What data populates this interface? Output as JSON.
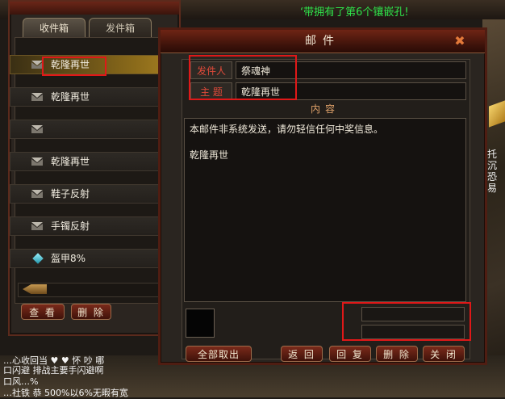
{
  "game": {
    "top_message": "‘带拥有了第6个镶嵌孔!",
    "right_message": "托沉 恐易",
    "bottom_line1": "…心收回当  ♥  ♥  怀 吵 哪",
    "bottom_line2": "口闪避 排战主要手闪避啊",
    "bottom_line3": "口风…%",
    "bottom_line4": "…社铁 恭 500%以6%无暇有宽"
  },
  "inbox": {
    "tabs": [
      {
        "label": "收件箱",
        "active": true
      },
      {
        "label": "发件箱",
        "active": false
      }
    ],
    "mails": [
      {
        "label": "乾隆再世",
        "icon": "envelope-icon",
        "selected": true
      },
      {
        "label": "乾隆再世",
        "icon": "envelope-icon",
        "selected": false
      },
      {
        "label": "",
        "icon": "envelope-icon",
        "selected": false
      },
      {
        "label": "乾隆再世",
        "icon": "envelope-icon",
        "selected": false
      },
      {
        "label": "鞋子反射",
        "icon": "envelope-icon",
        "selected": false
      },
      {
        "label": "手镯反射",
        "icon": "envelope-icon",
        "selected": false
      },
      {
        "label": "盔甲8%",
        "icon": "gem-icon",
        "selected": false
      }
    ],
    "view_button": "查 看",
    "delete_button": "删 除"
  },
  "dialog": {
    "title": "邮件",
    "sender_label": "发件人",
    "sender_value": "祭魂神",
    "subject_label": "主 题",
    "subject_value": "乾隆再世",
    "content_header": "内容",
    "content_line1": "本邮件非系统发送，请勿轻信任何中奖信息。",
    "content_line2": "乾隆再世",
    "buttons": {
      "take_all": "全部取出",
      "back": "返 回",
      "reply": "回 复",
      "delete": "删 除",
      "close": "关 闭"
    }
  },
  "colors": {
    "highlight": "#e01818",
    "label_red": "#e04a3a",
    "game_green": "#2fe14a"
  }
}
